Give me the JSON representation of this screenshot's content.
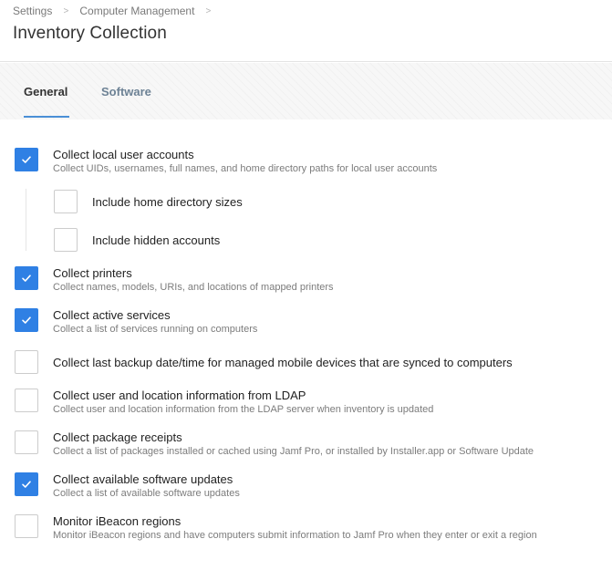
{
  "breadcrumb": {
    "items": [
      "Settings",
      "Computer Management"
    ],
    "separator": ">"
  },
  "page": {
    "title": "Inventory Collection"
  },
  "tabs": [
    {
      "label": "General",
      "active": true
    },
    {
      "label": "Software",
      "active": false
    }
  ],
  "colors": {
    "accent": "#2f80e4",
    "tab_underline": "#4a8fd6",
    "inactive_tab": "#6d8295"
  },
  "settings": [
    {
      "label": "Collect local user accounts",
      "description": "Collect UIDs, usernames, full names, and home directory paths for local user accounts",
      "checked": true
    },
    {
      "label": "Include home directory sizes",
      "description": "",
      "checked": false
    },
    {
      "label": "Include hidden accounts",
      "description": "",
      "checked": false
    },
    {
      "label": "Collect printers",
      "description": "Collect names, models, URIs, and locations of mapped printers",
      "checked": true
    },
    {
      "label": "Collect active services",
      "description": "Collect a list of services running on computers",
      "checked": true
    },
    {
      "label": "Collect last backup date/time for managed mobile devices that are synced to computers",
      "description": "",
      "checked": false
    },
    {
      "label": "Collect user and location information from LDAP",
      "description": "Collect user and location information from the LDAP server when inventory is updated",
      "checked": false
    },
    {
      "label": "Collect package receipts",
      "description": "Collect a list of packages installed or cached using Jamf Pro, or installed by Installer.app or Software Update",
      "checked": false
    },
    {
      "label": "Collect available software updates",
      "description": "Collect a list of available software updates",
      "checked": true
    },
    {
      "label": "Monitor iBeacon regions",
      "description": "Monitor iBeacon regions and have computers submit information to Jamf Pro when they enter or exit a region",
      "checked": false
    }
  ]
}
